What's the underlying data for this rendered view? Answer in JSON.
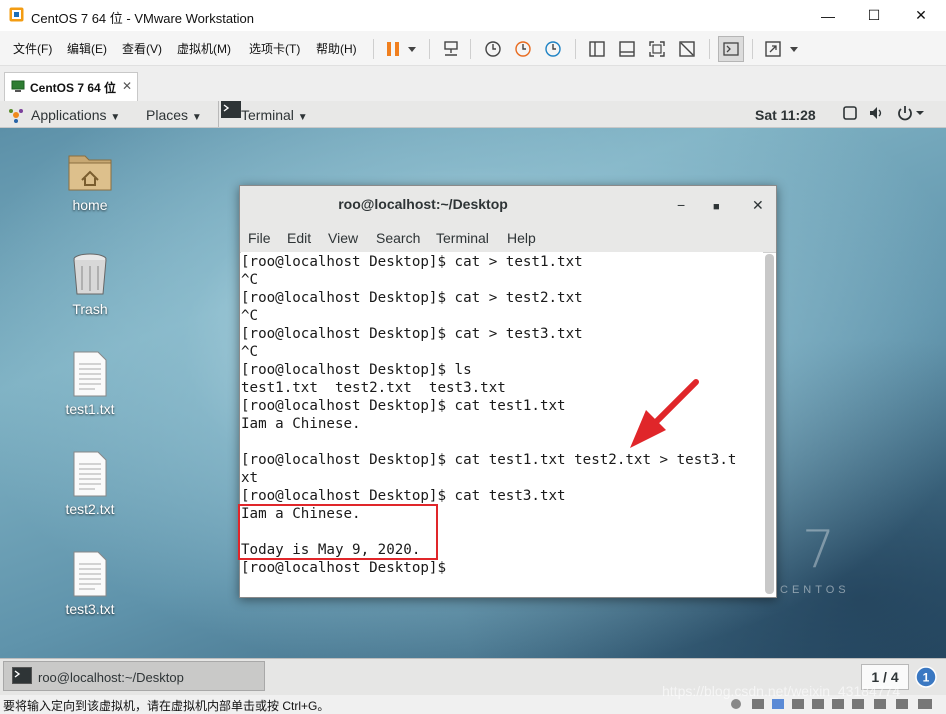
{
  "window": {
    "title": "CentOS 7 64 位 - VMware Workstation",
    "minimize_icon": "minimize-icon",
    "maximize_icon": "maximize-icon",
    "close_icon": "close-icon"
  },
  "menu": {
    "items": [
      "文件(F)",
      "编辑(E)",
      "查看(V)",
      "虚拟机(M)",
      "选项卡(T)",
      "帮助(H)"
    ]
  },
  "tab": {
    "label": "CentOS 7 64 位"
  },
  "gnome": {
    "applications": "Applications",
    "places": "Places",
    "terminal": "Terminal",
    "clock": "Sat 11:28"
  },
  "desktop": {
    "icons": [
      {
        "label": "home",
        "icon": "home-folder-icon"
      },
      {
        "label": "Trash",
        "icon": "trash-icon"
      },
      {
        "label": "test1.txt",
        "icon": "text-file-icon"
      },
      {
        "label": "test2.txt",
        "icon": "text-file-icon"
      },
      {
        "label": "test3.txt",
        "icon": "text-file-icon"
      }
    ],
    "logo_number": "7",
    "logo_word": "CENTOS"
  },
  "terminal": {
    "title": "roo@localhost:~/Desktop",
    "menu": [
      "File",
      "Edit",
      "View",
      "Search",
      "Terminal",
      "Help"
    ],
    "lines": [
      "[roo@localhost Desktop]$ cat > test1.txt",
      "^C",
      "[roo@localhost Desktop]$ cat > test2.txt",
      "^C",
      "[roo@localhost Desktop]$ cat > test3.txt",
      "^C",
      "[roo@localhost Desktop]$ ls",
      "test1.txt  test2.txt  test3.txt",
      "[roo@localhost Desktop]$ cat test1.txt",
      "Iam a Chinese.",
      "",
      "[roo@localhost Desktop]$ cat test1.txt test2.txt > test3.t",
      "xt",
      "[roo@localhost Desktop]$ cat test3.txt",
      "Iam a Chinese.",
      "",
      "Today is May 9, 2020.",
      "[roo@localhost Desktop]$"
    ],
    "annotation_colors": {
      "box": "#e0262a",
      "arrow": "#e0262a"
    }
  },
  "taskbar": {
    "item": "roo@localhost:~/Desktop",
    "pager": "1 / 4"
  },
  "status": {
    "text": "要将输入定向到该虚拟机，请在虚拟机内部单击或按 Ctrl+G。"
  },
  "watermark": "https://blog.csdn.net/weixin_43184774"
}
